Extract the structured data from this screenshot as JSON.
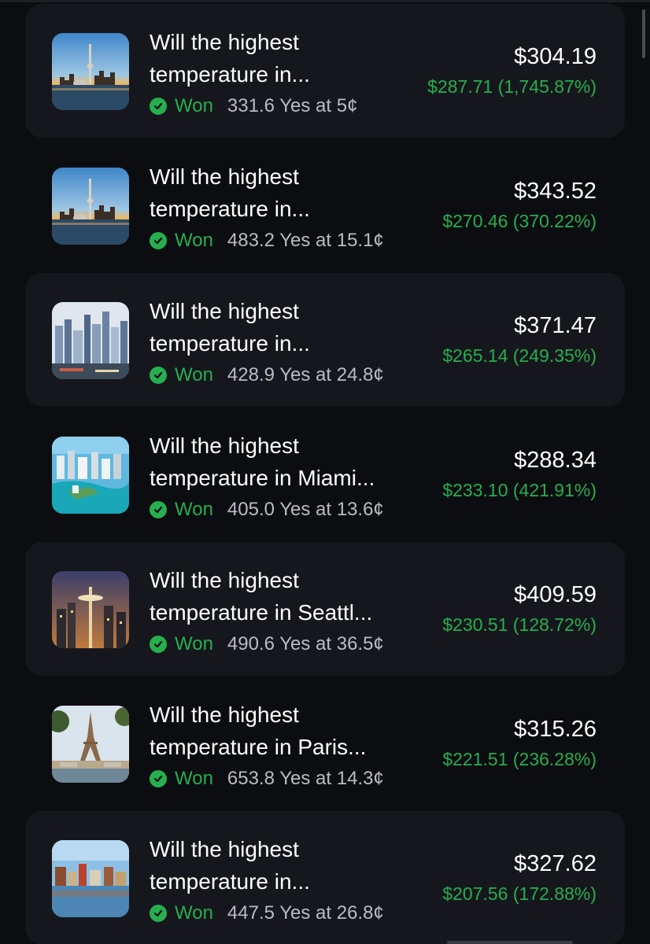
{
  "positions": [
    {
      "title_line1": "Will the highest",
      "title_line2": "temperature in...",
      "status": "Won",
      "detail": "331.6 Yes at 5¢",
      "value": "$304.19",
      "pnl": "$287.71 (1,745.87%)",
      "thumb": "toronto-skyline-image"
    },
    {
      "title_line1": "Will the highest",
      "title_line2": "temperature in...",
      "status": "Won",
      "detail": "483.2 Yes at 15.1¢",
      "value": "$343.52",
      "pnl": "$270.46 (370.22%)",
      "thumb": "toronto-skyline-image"
    },
    {
      "title_line1": "Will the highest",
      "title_line2": "temperature in...",
      "status": "Won",
      "detail": "428.9 Yes at 24.8¢",
      "value": "$371.47",
      "pnl": "$265.14 (249.35%)",
      "thumb": "city-skyline-image"
    },
    {
      "title_line1": "Will the highest",
      "title_line2": "temperature in Miami...",
      "status": "Won",
      "detail": "405.0 Yes at 13.6¢",
      "value": "$288.34",
      "pnl": "$233.10 (421.91%)",
      "thumb": "miami-image"
    },
    {
      "title_line1": "Will the highest",
      "title_line2": "temperature in Seattl...",
      "status": "Won",
      "detail": "490.6 Yes at 36.5¢",
      "value": "$409.59",
      "pnl": "$230.51 (128.72%)",
      "thumb": "seattle-space-needle-image"
    },
    {
      "title_line1": "Will the highest",
      "title_line2": "temperature in Paris...",
      "status": "Won",
      "detail": "653.8 Yes at 14.3¢",
      "value": "$315.26",
      "pnl": "$221.51 (236.28%)",
      "thumb": "paris-eiffel-tower-image"
    },
    {
      "title_line1": "Will the highest",
      "title_line2": "temperature in...",
      "status": "Won",
      "detail": "447.5 Yes at 26.8¢",
      "value": "$327.62",
      "pnl": "$207.56 (172.88%)",
      "thumb": "riverside-city-image"
    }
  ],
  "colors": {
    "background": "#0c0d10",
    "card": "#16171c",
    "won": "#27ae4f",
    "muted": "#b9bcc4"
  }
}
